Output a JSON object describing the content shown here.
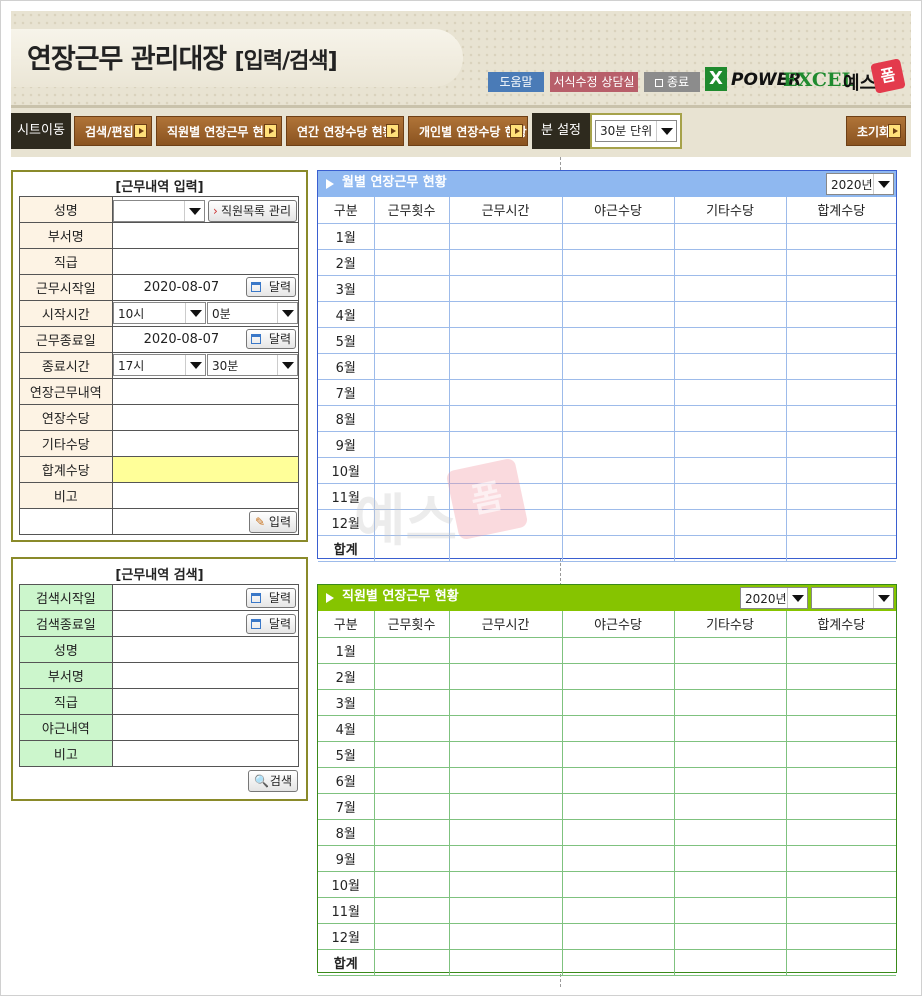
{
  "header": {
    "title": "연장근무 관리대장",
    "subtitle": "[입력/검색]",
    "buttons": [
      {
        "label": "도움말",
        "color": "#4a7bb7"
      },
      {
        "label": "서식수정 상담실",
        "color": "#b85f6a"
      },
      {
        "label": "종료",
        "color": "#8c8c8c"
      }
    ],
    "logo": {
      "power": "POWER",
      "excel": "EXCEL",
      "yes": "예스",
      "pum": "폼"
    }
  },
  "nav": {
    "sheet_label": "시트이동",
    "buttons": [
      "검색/편집",
      "직원별 연장근무 현황",
      "연간 연장수당 현황",
      "개인별 연장수당 현황"
    ],
    "unit_label": "분 설정",
    "unit_value": "30분 단위",
    "reset_label": "초기화"
  },
  "input_panel": {
    "title": "[근무내역 입력]",
    "fields": {
      "name": "성명",
      "dept": "부서명",
      "rank": "직급",
      "start_date": "근무시작일",
      "start_time": "시작시간",
      "end_date": "근무종료일",
      "end_time": "종료시간",
      "detail": "연장근무내역",
      "ot_pay": "연장수당",
      "other_pay": "기타수당",
      "total_pay": "합계수당",
      "note": "비고"
    },
    "start_date_value": "2020-08-07",
    "end_date_value": "2020-08-07",
    "start_hour": "10시",
    "start_min": "0분",
    "end_hour": "17시",
    "end_min": "30분",
    "staff_button": "직원목록 관리",
    "calendar_label": "달력",
    "input_button": "입력"
  },
  "search_panel": {
    "title": "[근무내역 검색]",
    "fields": {
      "start": "검색시작일",
      "end": "검색종료일",
      "name": "성명",
      "dept": "부서명",
      "rank": "직급",
      "night": "야근내역",
      "note": "비고"
    },
    "calendar_label": "달력",
    "search_button": "검색"
  },
  "monthly": {
    "title": "월별 연장근무 현황",
    "year": "2020년",
    "columns": [
      "구분",
      "근무횟수",
      "근무시간",
      "야근수당",
      "기타수당",
      "합계수당"
    ],
    "rows": [
      "1월",
      "2월",
      "3월",
      "4월",
      "5월",
      "6월",
      "7월",
      "8월",
      "9월",
      "10월",
      "11월",
      "12월"
    ],
    "total": "합계",
    "color": "#8fb8f0"
  },
  "staff": {
    "title": "직원별 연장근무 현황",
    "year": "2020년",
    "staff_value": "",
    "columns": [
      "구분",
      "근무횟수",
      "근무시간",
      "야근수당",
      "기타수당",
      "합계수당"
    ],
    "rows": [
      "1월",
      "2월",
      "3월",
      "4월",
      "5월",
      "6월",
      "7월",
      "8월",
      "9월",
      "10월",
      "11월",
      "12월"
    ],
    "total": "합계",
    "color": "#86c400"
  },
  "watermark": {
    "text": "예스",
    "pum": "폼"
  }
}
